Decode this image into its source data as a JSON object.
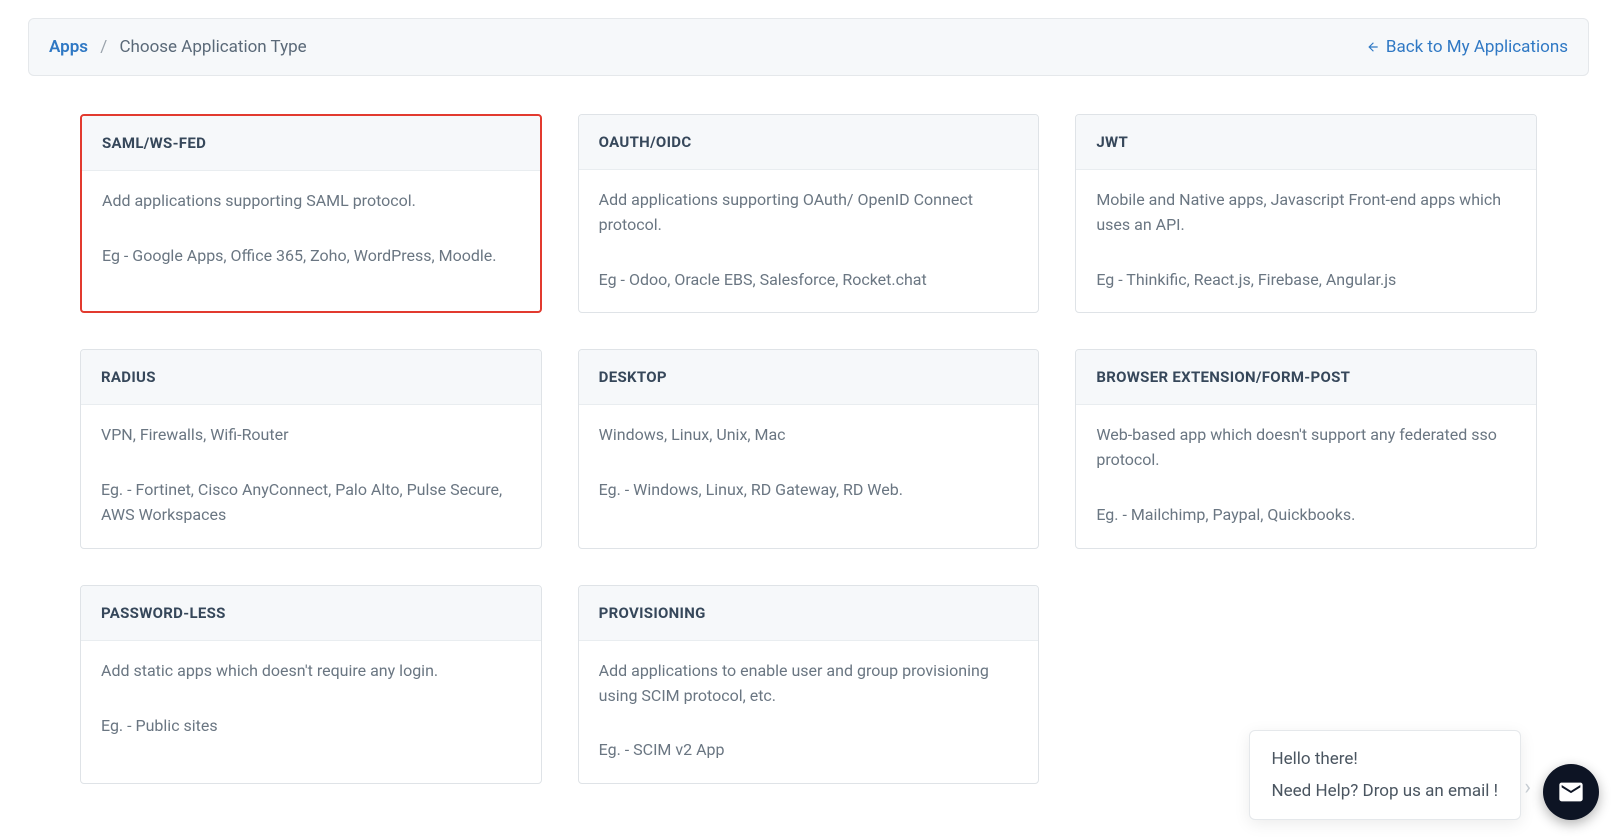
{
  "breadcrumb": {
    "root": "Apps",
    "current": "Choose Application Type"
  },
  "back_link": "Back to My Applications",
  "cards": [
    {
      "title": "SAML/WS-FED",
      "desc": "Add applications supporting SAML protocol.",
      "example": "Eg - Google Apps, Office 365, Zoho, WordPress, Moodle.",
      "selected": true
    },
    {
      "title": "OAUTH/OIDC",
      "desc": "Add applications supporting OAuth/ OpenID Connect protocol.",
      "example": "Eg - Odoo, Oracle EBS, Salesforce, Rocket.chat",
      "selected": false
    },
    {
      "title": "JWT",
      "desc": "Mobile and Native apps, Javascript Front-end apps which uses an API.",
      "example": "Eg - Thinkific, React.js, Firebase, Angular.js",
      "selected": false
    },
    {
      "title": "RADIUS",
      "desc": "VPN, Firewalls, Wifi-Router",
      "example": "Eg. - Fortinet, Cisco AnyConnect, Palo Alto, Pulse Secure, AWS Workspaces",
      "selected": false
    },
    {
      "title": "DESKTOP",
      "desc": "Windows, Linux, Unix, Mac",
      "example": "Eg. - Windows, Linux, RD Gateway, RD Web.",
      "selected": false
    },
    {
      "title": "BROWSER EXTENSION/FORM-POST",
      "desc": "Web-based app which doesn't support any federated sso protocol.",
      "example": "Eg. - Mailchimp, Paypal, Quickbooks.",
      "selected": false
    },
    {
      "title": "PASSWORD-LESS",
      "desc": "Add static apps which doesn't require any login.",
      "example": "Eg. - Public sites",
      "selected": false
    },
    {
      "title": "PROVISIONING",
      "desc": "Add applications to enable user and group provisioning using SCIM protocol, etc.",
      "example": "Eg. - SCIM v2 App",
      "selected": false
    }
  ],
  "chat": {
    "line1": "Hello there!",
    "line2": "Need Help? Drop us an email !"
  }
}
